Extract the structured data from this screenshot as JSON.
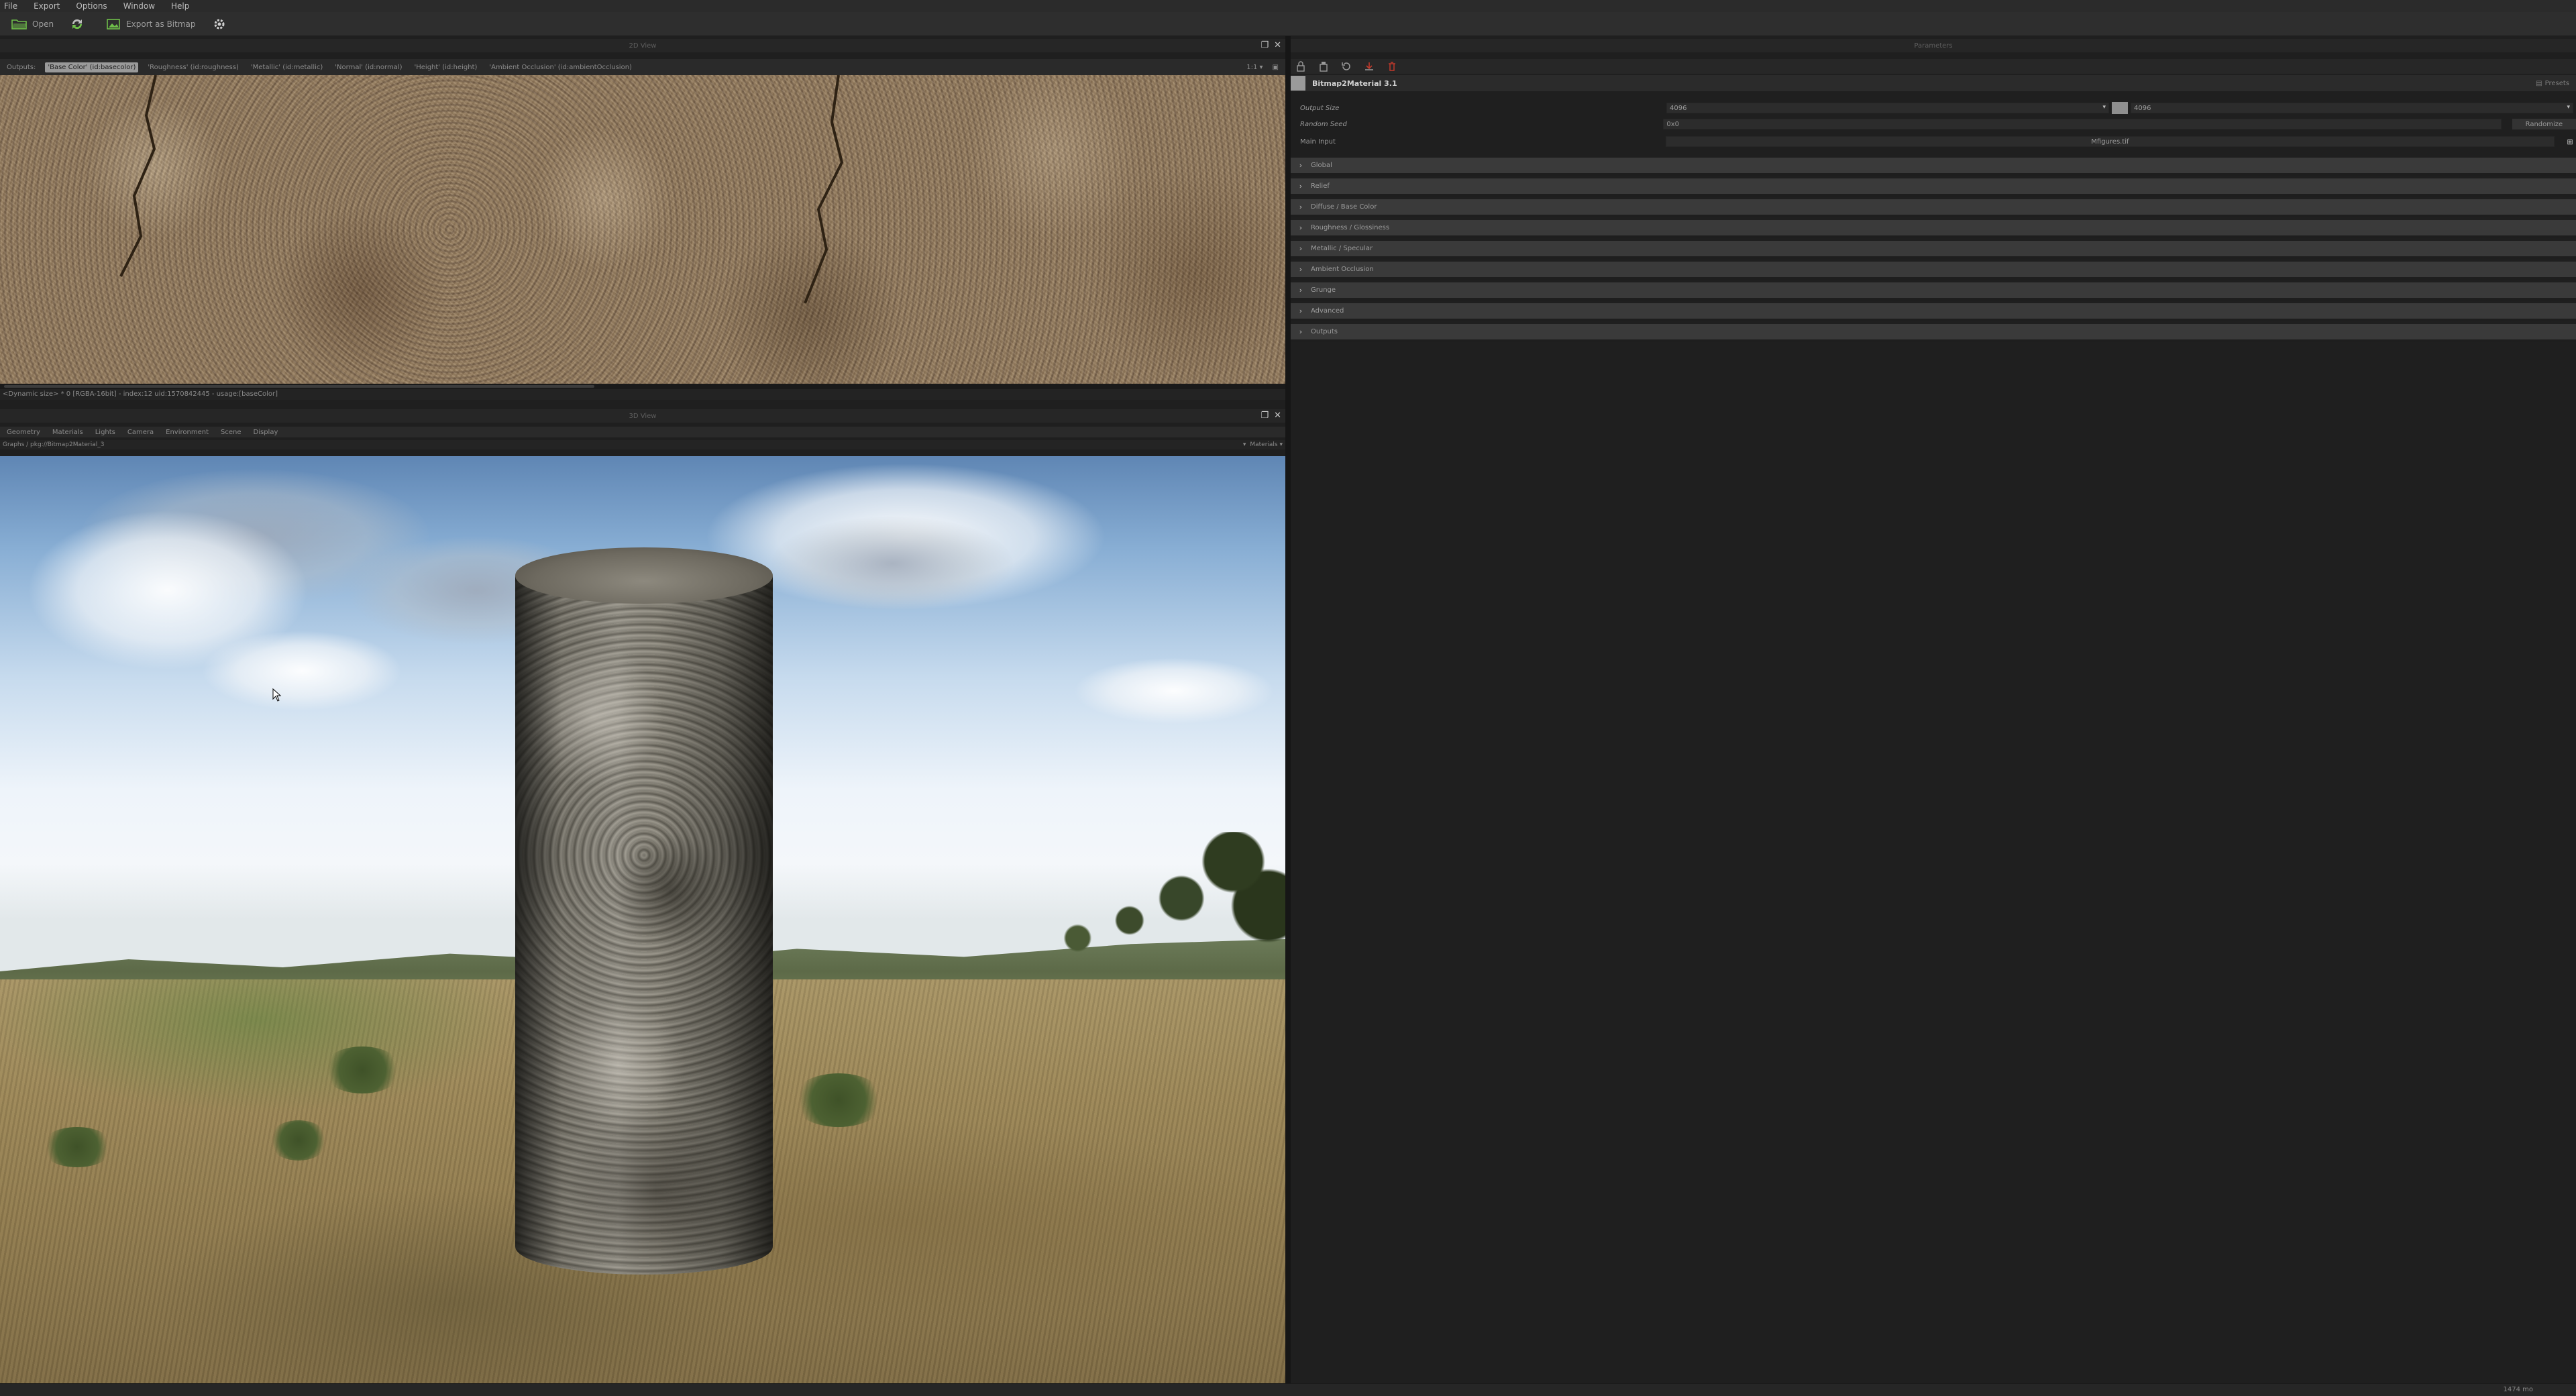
{
  "menu": [
    "File",
    "Export",
    "Options",
    "Window",
    "Help"
  ],
  "toolbar": {
    "open_label": "Open",
    "export_label": "Export as Bitmap"
  },
  "view2d": {
    "title": "2D View",
    "outputs_label": "Outputs:",
    "tabs": [
      {
        "label": "'Base Color' (id:basecolor)",
        "active": true
      },
      {
        "label": "'Roughness' (id:roughness)",
        "active": false
      },
      {
        "label": "'Metallic' (id:metallic)",
        "active": false
      },
      {
        "label": "'Normal' (id:normal)",
        "active": false
      },
      {
        "label": "'Height' (id:height)",
        "active": false
      },
      {
        "label": "'Ambient Occlusion' (id:ambientOcclusion)",
        "active": false
      }
    ],
    "zoom": "1:1",
    "status": "<Dynamic size> * 0 [RGBA-16bit] - index:12 uid:1570842445 - usage:[baseColor]"
  },
  "view3d": {
    "title": "3D View",
    "menu": [
      "Geometry",
      "Materials",
      "Lights",
      "Camera",
      "Environment",
      "Scene",
      "Display"
    ],
    "graph_path": "Graphs / pkg://Bitmap2Material_3",
    "materials_label": "Materials"
  },
  "params": {
    "title": "Parameters",
    "graph_name": "Bitmap2Material 3.1",
    "presets_label": "Presets",
    "output_size_label": "Output Size",
    "output_size_w": "4096",
    "output_size_h": "4096",
    "random_seed_label": "Random Seed",
    "random_seed_value": "0x0",
    "randomize_label": "Randomize",
    "main_input_label": "Main Input",
    "main_input_value": "Mfigures.tif",
    "sections": [
      "Global",
      "Relief",
      "Diffuse / Base Color",
      "Roughness / Glossiness",
      "Metallic / Specular",
      "Ambient Occlusion",
      "Grunge",
      "Advanced",
      "Outputs"
    ]
  },
  "bottom": {
    "memory": "1474 mo"
  },
  "colors": {
    "panel_bg": "#1f1f1f",
    "section_bg": "#3a3a3a",
    "active_tab": "#9a9a9a",
    "accent_green": "#6fbf4a",
    "accent_red": "#c0392b"
  }
}
